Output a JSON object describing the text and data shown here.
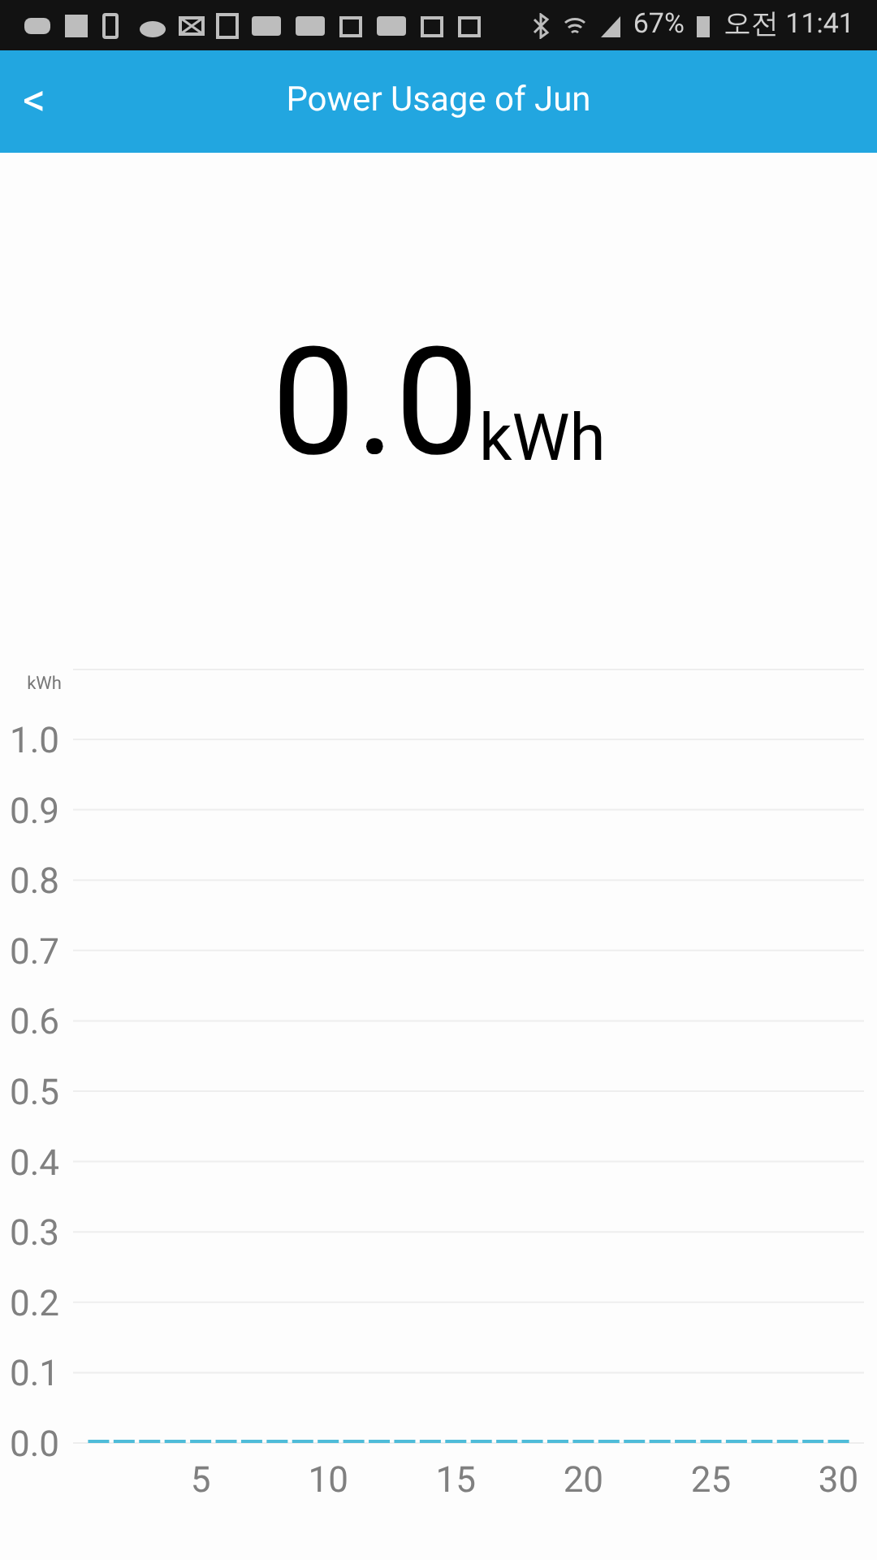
{
  "status_bar": {
    "battery": "67%",
    "time": "오전 11:41"
  },
  "header": {
    "back": "<",
    "title": "Power Usage of Jun"
  },
  "total": {
    "value": "0.0",
    "unit": "kWh"
  },
  "chart_data": {
    "type": "bar",
    "ylabel": "kWh",
    "grid": true,
    "x": [
      1,
      2,
      3,
      4,
      5,
      6,
      7,
      8,
      9,
      10,
      11,
      12,
      13,
      14,
      15,
      16,
      17,
      18,
      19,
      20,
      21,
      22,
      23,
      24,
      25,
      26,
      27,
      28,
      29,
      30
    ],
    "xlim": [
      0,
      31
    ],
    "series": [
      {
        "color": "#4fbcd9",
        "values": [
          0,
          0,
          0,
          0,
          0,
          0,
          0,
          0,
          0,
          0,
          0,
          0,
          0,
          0,
          0,
          0,
          0,
          0,
          0,
          0,
          0,
          0,
          0,
          0,
          0,
          0,
          0,
          0,
          0,
          0
        ]
      }
    ],
    "ylim": [
      0,
      1
    ],
    "yticks": [
      {
        "value": 0,
        "label": "0.0"
      },
      {
        "value": 0.1,
        "label": "0.1"
      },
      {
        "value": 0.2,
        "label": "0.2"
      },
      {
        "value": 0.3,
        "label": "0.3"
      },
      {
        "value": 0.4,
        "label": "0.4"
      },
      {
        "value": 0.5,
        "label": "0.5"
      },
      {
        "value": 0.6,
        "label": "0.6"
      },
      {
        "value": 0.7,
        "label": "0.7"
      },
      {
        "value": 0.8,
        "label": "0.8"
      },
      {
        "value": 0.9,
        "label": "0.9"
      },
      {
        "value": 1,
        "label": "1.0"
      }
    ],
    "xticks": [
      5,
      10,
      15,
      20,
      25,
      30
    ]
  }
}
